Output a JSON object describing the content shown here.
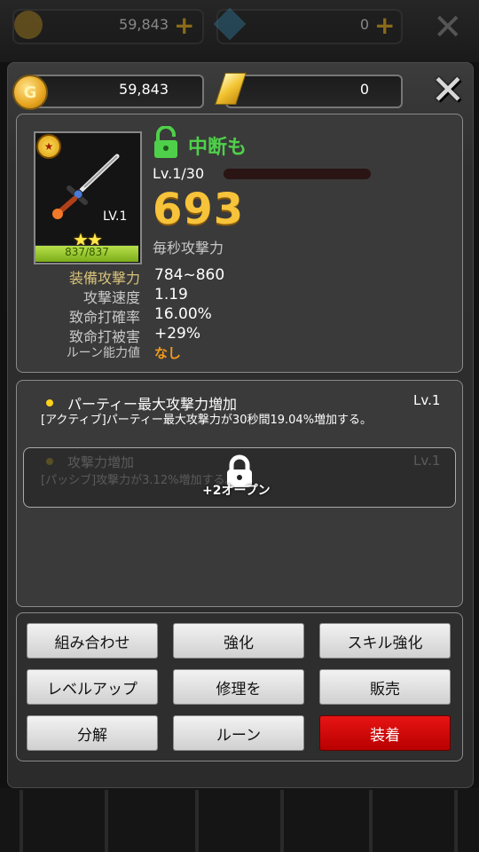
{
  "background": {
    "gold_value": "59,843",
    "gem_value": "0"
  },
  "currency": {
    "gold_value": "59,843",
    "gold_icon_letter": "G",
    "crystal_value": "0"
  },
  "item": {
    "level_badge": "LV.1",
    "durability": "837/837",
    "stars": 2,
    "name": "中断も",
    "level_text": "Lv.1/30",
    "exp_fraction": 0.0,
    "power": "693",
    "power_label": "毎秒攻撃力",
    "stats": [
      {
        "label": "装備攻撃力",
        "value": "784~860"
      },
      {
        "label": "攻撃速度",
        "value": "1.19"
      },
      {
        "label": "致命打確率",
        "value": "16.00%"
      },
      {
        "label": "致命打被害",
        "value": "+29%"
      },
      {
        "label": "ルーン能力値",
        "value": "なし"
      }
    ]
  },
  "skills": {
    "active": {
      "title": "パーティー最大攻撃力増加",
      "level": "Lv.1",
      "desc": "[アクティブ]パーティー最大攻撃力が30秒間19.04%増加する。"
    },
    "passive": {
      "title": "攻撃力増加",
      "level": "Lv.1",
      "desc": "[パッシブ]攻撃力が3.12%増加する。",
      "lock_text": "+2オープン"
    }
  },
  "buttons": [
    "組み合わせ",
    "強化",
    "スキル強化",
    "レベルアップ",
    "修理を",
    "販売",
    "分解",
    "ルーン",
    "装着"
  ],
  "colors": {
    "gold": "#f6c33a",
    "green": "#4fd04a",
    "red_button": "#d00000"
  }
}
